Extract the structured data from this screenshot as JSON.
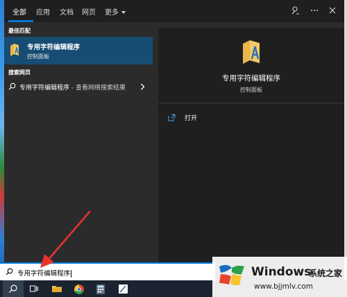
{
  "top_tabs": [
    {
      "label": "全部"
    },
    {
      "label": "应用"
    },
    {
      "label": "文档"
    },
    {
      "label": "网页"
    },
    {
      "label": "更多"
    }
  ],
  "left": {
    "best_match_heading": "最佳匹配",
    "best_match": {
      "title": "专用字符编辑程序",
      "subtitle": "控制面板",
      "icon": "folder-font-icon"
    },
    "web_heading": "搜索网页",
    "web_item": {
      "query": "专用字符编辑程序",
      "suffix": " - 查看网络搜索结果"
    }
  },
  "preview": {
    "title": "专用字符编辑程序",
    "subtitle": "控制面板",
    "actions": [
      {
        "label": "打开",
        "icon": "open-icon"
      }
    ]
  },
  "search": {
    "value": "专用字符编辑程序"
  },
  "taskbar": {
    "items": [
      "search-icon",
      "task-view-icon",
      "file-explorer-icon",
      "chrome-icon",
      "calculator-icon",
      "notepad-icon"
    ]
  },
  "watermark": {
    "brand": "Windows",
    "cn": "系统之家",
    "url": "www.bjjmlv.com"
  },
  "colors": {
    "accent": "#0078d7",
    "selected": "#174c73",
    "arrow": "#e8322c"
  }
}
